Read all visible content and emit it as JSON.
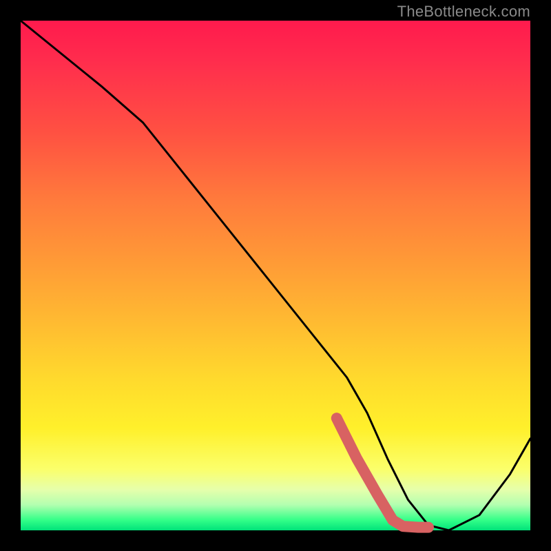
{
  "watermark": "TheBottleneck.com",
  "chart_data": {
    "type": "line",
    "title": "",
    "xlabel": "",
    "ylabel": "",
    "xlim": [
      0,
      100
    ],
    "ylim": [
      0,
      100
    ],
    "grid": false,
    "series": [
      {
        "name": "curve",
        "color": "#000000",
        "x": [
          0,
          16,
          24,
          32,
          40,
          48,
          56,
          64,
          68,
          72,
          76,
          80,
          84,
          90,
          96,
          100
        ],
        "values": [
          100,
          87,
          80,
          70,
          60,
          50,
          40,
          30,
          23,
          14,
          6,
          1,
          0,
          3,
          11,
          18
        ]
      },
      {
        "name": "highlight",
        "color": "#d86262",
        "x": [
          62,
          66,
          70,
          73,
          75,
          78,
          80
        ],
        "values": [
          22,
          14,
          7,
          2,
          0.8,
          0.6,
          0.6
        ]
      }
    ],
    "annotations": []
  }
}
